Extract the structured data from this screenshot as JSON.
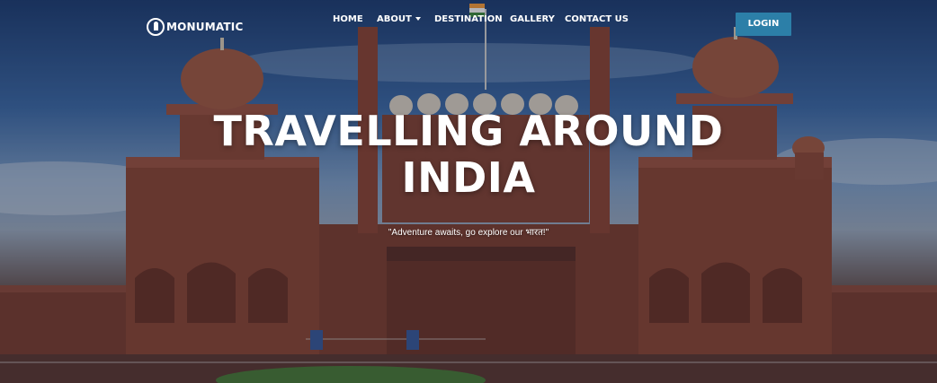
{
  "brand": {
    "name": "MONUMATIC",
    "logo_icon": "monument-icon"
  },
  "nav": {
    "items": [
      {
        "label": "HOME"
      },
      {
        "label": "ABOUT",
        "has_dropdown": true
      },
      {
        "label": "DESTINATION"
      },
      {
        "label": "GALLERY"
      },
      {
        "label": "CONTACT US"
      }
    ],
    "login_label": "LOGIN"
  },
  "hero": {
    "title_line1": "TRAVELLING AROUND",
    "title_line2": "INDIA",
    "tagline": "\"Adventure awaits, go explore our भारत!\""
  },
  "colors": {
    "login_button": "#2c7fa8",
    "sandstone": "#8a4a3a",
    "sky": "#3d6aa6"
  }
}
